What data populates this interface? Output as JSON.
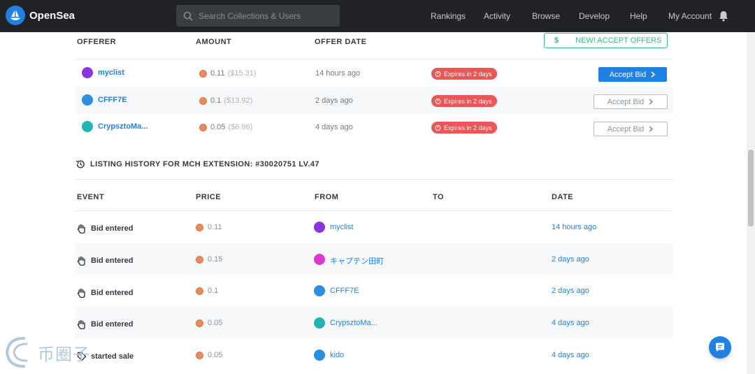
{
  "header": {
    "brand": "OpenSea",
    "search_placeholder": "Search Collections & Users",
    "nav": [
      "Rankings",
      "Activity",
      "Browse",
      "Develop",
      "Help",
      "My Account"
    ]
  },
  "offers": {
    "columns": [
      "OFFERER",
      "AMOUNT",
      "OFFER DATE"
    ],
    "accept_offers_label": "NEW! ACCEPT OFFERS",
    "accept_offers_icon_text": "$",
    "rows": [
      {
        "name": "myclist",
        "avatar_color": "#8a36e0",
        "amount": "0.11",
        "usd": "($15.31)",
        "date": "14 hours ago",
        "expires": "Expires in 2 days",
        "button": "Accept Bid"
      },
      {
        "name": "CFFF7E",
        "avatar_color": "#2a8fe0",
        "amount": "0.1",
        "usd": "($13.92)",
        "date": "2 days ago",
        "expires": "Expires in 2 days",
        "button": "Accept Bid"
      },
      {
        "name": "CrypsztoMa...",
        "avatar_color": "#23b3b0",
        "amount": "0.05",
        "usd": "($6.96)",
        "date": "4 days ago",
        "expires": "Expires in 2 days",
        "button": "Accept Bid"
      }
    ]
  },
  "history": {
    "title": "LISTING HISTORY FOR MCH EXTENSION: #30020751 LV.47",
    "columns": [
      "EVENT",
      "PRICE",
      "FROM",
      "TO",
      "DATE"
    ],
    "rows": [
      {
        "event": "Bid entered",
        "price": "0.11",
        "from": "myclist",
        "from_color": "#8a36e0",
        "date": "14 hours ago"
      },
      {
        "event": "Bid entered",
        "price": "0.15",
        "from": "キャプテン田町",
        "from_color": "#d93ad0",
        "date": "2 days ago"
      },
      {
        "event": "Bid entered",
        "price": "0.1",
        "from": "CFFF7E",
        "from_color": "#2a8fe0",
        "date": "2 days ago"
      },
      {
        "event": "Bid entered",
        "price": "0.05",
        "from": "CrypsztoMa...",
        "from_color": "#23b3b0",
        "date": "4 days ago"
      },
      {
        "event": "started sale",
        "price": "0.05",
        "from": "kido",
        "from_color": "#2a8fe0",
        "date": "4 days ago"
      }
    ]
  },
  "watermark": "币圈子",
  "colors": {
    "accent": "#2081e2",
    "danger": "#eb5757",
    "success": "#3cb878",
    "nav_bg": "#202225"
  }
}
